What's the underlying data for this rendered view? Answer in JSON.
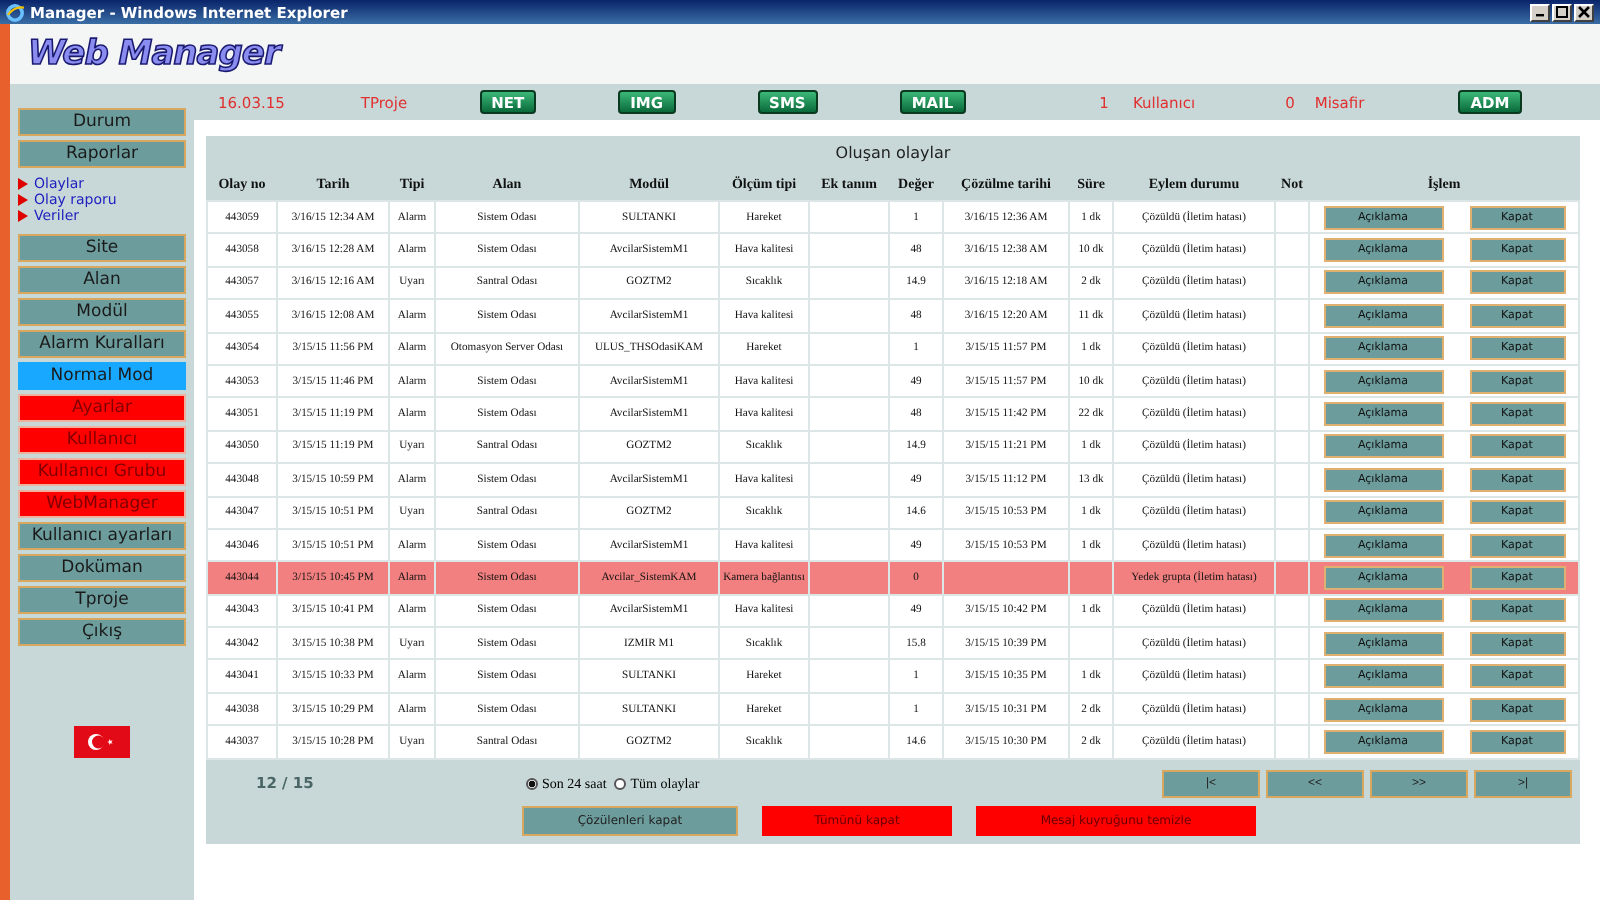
{
  "window": {
    "title": "Manager - Windows Internet Explorer"
  },
  "logo": "Web Manager",
  "sidebar": {
    "items": [
      {
        "label": "Durum",
        "kind": "button"
      },
      {
        "label": "Raporlar",
        "kind": "button"
      },
      {
        "label": "Olaylar",
        "kind": "link"
      },
      {
        "label": "Olay raporu",
        "kind": "link"
      },
      {
        "label": "Veriler",
        "kind": "link"
      },
      {
        "label": "Site",
        "kind": "button"
      },
      {
        "label": "Alan",
        "kind": "button"
      },
      {
        "label": "Modül",
        "kind": "button"
      },
      {
        "label": "Alarm Kuralları",
        "kind": "button"
      },
      {
        "label": "Normal Mod",
        "kind": "mode"
      },
      {
        "label": "Ayarlar",
        "kind": "admin"
      },
      {
        "label": "Kullanıcı",
        "kind": "admin"
      },
      {
        "label": "Kullanıcı Grubu",
        "kind": "admin"
      },
      {
        "label": "WebManager",
        "kind": "admin"
      },
      {
        "label": "Kullanıcı ayarları",
        "kind": "button"
      },
      {
        "label": "Doküman",
        "kind": "button"
      },
      {
        "label": "Tproje",
        "kind": "button"
      },
      {
        "label": "Çıkış",
        "kind": "button"
      }
    ]
  },
  "topbar": {
    "date": "16.03.15",
    "project": "TProje",
    "buttons": [
      "NET",
      "IMG",
      "SMS",
      "MAIL"
    ],
    "users_count": "1",
    "users_label": "Kullanıcı",
    "guests_count": "0",
    "guests_label": "Misafir",
    "admin_button": "ADM"
  },
  "events": {
    "title": "Oluşan olaylar",
    "columns": [
      "Olay no",
      "Tarih",
      "Tipi",
      "Alan",
      "Modül",
      "Ölçüm tipi",
      "Ek tanım",
      "Değer",
      "Çözülme tarihi",
      "Süre",
      "Eylem durumu",
      "Not",
      "İşlem"
    ],
    "rows": [
      {
        "cells": [
          "443059",
          "3/16/15 12:34 AM",
          "Alarm",
          "Sistem Odası",
          "SULTANKI",
          "Hareket",
          "",
          "1",
          "3/16/15 12:36 AM",
          "1 dk",
          "Çözüldü (İletim hatası)",
          ""
        ],
        "actions": [
          "Açıklama",
          "Kapat"
        ],
        "highlighted": false
      },
      {
        "cells": [
          "443058",
          "3/16/15 12:28 AM",
          "Alarm",
          "Sistem Odası",
          "AvcilarSistemM1",
          "Hava kalitesi",
          "",
          "48",
          "3/16/15 12:38 AM",
          "10 dk",
          "Çözüldü (İletim hatası)",
          ""
        ],
        "actions": [
          "Açıklama",
          "Kapat"
        ],
        "highlighted": false
      },
      {
        "cells": [
          "443057",
          "3/16/15 12:16 AM",
          "Uyarı",
          "Santral Odası",
          "GOZTM2",
          "Sıcaklık",
          "",
          "14.9",
          "3/16/15 12:18 AM",
          "2 dk",
          "Çözüldü (İletim hatası)",
          ""
        ],
        "actions": [
          "Açıklama",
          "Kapat"
        ],
        "highlighted": false
      },
      {
        "cells": [
          "443055",
          "3/16/15 12:08 AM",
          "Alarm",
          "Sistem Odası",
          "AvcilarSistemM1",
          "Hava kalitesi",
          "",
          "48",
          "3/16/15 12:20 AM",
          "11 dk",
          "Çözüldü (İletim hatası)",
          ""
        ],
        "actions": [
          "Açıklama",
          "Kapat"
        ],
        "highlighted": false
      },
      {
        "cells": [
          "443054",
          "3/15/15 11:56 PM",
          "Alarm",
          "Otomasyon Server Odası",
          "ULUS_THSOdasiKAM",
          "Hareket",
          "",
          "1",
          "3/15/15 11:57 PM",
          "1 dk",
          "Çözüldü (İletim hatası)",
          ""
        ],
        "actions": [
          "Açıklama",
          "Kapat"
        ],
        "highlighted": false
      },
      {
        "cells": [
          "443053",
          "3/15/15 11:46 PM",
          "Alarm",
          "Sistem Odası",
          "AvcilarSistemM1",
          "Hava kalitesi",
          "",
          "49",
          "3/15/15 11:57 PM",
          "10 dk",
          "Çözüldü (İletim hatası)",
          ""
        ],
        "actions": [
          "Açıklama",
          "Kapat"
        ],
        "highlighted": false
      },
      {
        "cells": [
          "443051",
          "3/15/15 11:19 PM",
          "Alarm",
          "Sistem Odası",
          "AvcilarSistemM1",
          "Hava kalitesi",
          "",
          "48",
          "3/15/15 11:42 PM",
          "22 dk",
          "Çözüldü (İletim hatası)",
          ""
        ],
        "actions": [
          "Açıklama",
          "Kapat"
        ],
        "highlighted": false
      },
      {
        "cells": [
          "443050",
          "3/15/15 11:19 PM",
          "Uyarı",
          "Santral Odası",
          "GOZTM2",
          "Sıcaklık",
          "",
          "14.9",
          "3/15/15 11:21 PM",
          "1 dk",
          "Çözüldü (İletim hatası)",
          ""
        ],
        "actions": [
          "Açıklama",
          "Kapat"
        ],
        "highlighted": false
      },
      {
        "cells": [
          "443048",
          "3/15/15 10:59 PM",
          "Alarm",
          "Sistem Odası",
          "AvcilarSistemM1",
          "Hava kalitesi",
          "",
          "49",
          "3/15/15 11:12 PM",
          "13 dk",
          "Çözüldü (İletim hatası)",
          ""
        ],
        "actions": [
          "Açıklama",
          "Kapat"
        ],
        "highlighted": false
      },
      {
        "cells": [
          "443047",
          "3/15/15 10:51 PM",
          "Uyarı",
          "Santral Odası",
          "GOZTM2",
          "Sıcaklık",
          "",
          "14.6",
          "3/15/15 10:53 PM",
          "1 dk",
          "Çözüldü (İletim hatası)",
          ""
        ],
        "actions": [
          "Açıklama",
          "Kapat"
        ],
        "highlighted": false
      },
      {
        "cells": [
          "443046",
          "3/15/15 10:51 PM",
          "Alarm",
          "Sistem Odası",
          "AvcilarSistemM1",
          "Hava kalitesi",
          "",
          "49",
          "3/15/15 10:53 PM",
          "1 dk",
          "Çözüldü (İletim hatası)",
          ""
        ],
        "actions": [
          "Açıklama",
          "Kapat"
        ],
        "highlighted": false
      },
      {
        "cells": [
          "443044",
          "3/15/15 10:45 PM",
          "Alarm",
          "Sistem Odası",
          "Avcilar_SistemKAM",
          "Kamera bağlantısı",
          "",
          "0",
          "",
          "",
          "Yedek grupta (İletim hatası)",
          ""
        ],
        "actions": [
          "Açıklama",
          "Kapat"
        ],
        "highlighted": true
      },
      {
        "cells": [
          "443043",
          "3/15/15 10:41 PM",
          "Alarm",
          "Sistem Odası",
          "AvcilarSistemM1",
          "Hava kalitesi",
          "",
          "49",
          "3/15/15 10:42 PM",
          "1 dk",
          "Çözüldü (İletim hatası)",
          ""
        ],
        "actions": [
          "Açıklama",
          "Kapat"
        ],
        "highlighted": false
      },
      {
        "cells": [
          "443042",
          "3/15/15 10:38 PM",
          "Uyarı",
          "Sistem Odası",
          "IZMIR M1",
          "Sıcaklık",
          "",
          "15.8",
          "3/15/15 10:39 PM",
          "",
          "Çözüldü (İletim hatası)",
          ""
        ],
        "actions": [
          "Açıklama",
          "Kapat"
        ],
        "highlighted": false
      },
      {
        "cells": [
          "443041",
          "3/15/15 10:33 PM",
          "Alarm",
          "Sistem Odası",
          "SULTANKI",
          "Hareket",
          "",
          "1",
          "3/15/15 10:35 PM",
          "1 dk",
          "Çözüldü (İletim hatası)",
          ""
        ],
        "actions": [
          "Açıklama",
          "Kapat"
        ],
        "highlighted": false
      },
      {
        "cells": [
          "443038",
          "3/15/15 10:29 PM",
          "Alarm",
          "Sistem Odası",
          "SULTANKI",
          "Hareket",
          "",
          "1",
          "3/15/15 10:31 PM",
          "2 dk",
          "Çözüldü (İletim hatası)",
          ""
        ],
        "actions": [
          "Açıklama",
          "Kapat"
        ],
        "highlighted": false
      },
      {
        "cells": [
          "443037",
          "3/15/15 10:28 PM",
          "Uyarı",
          "Santral Odası",
          "GOZTM2",
          "Sıcaklık",
          "",
          "14.6",
          "3/15/15 10:30 PM",
          "2 dk",
          "Çözüldü (İletim hatası)",
          ""
        ],
        "actions": [
          "Açıklama",
          "Kapat"
        ],
        "highlighted": false
      }
    ]
  },
  "footer": {
    "page": "12 / 15",
    "radios": [
      {
        "label": "Son 24 saat",
        "selected": true
      },
      {
        "label": "Tüm olaylar",
        "selected": false
      }
    ],
    "pager": [
      "|<",
      "<<",
      ">>",
      ">|"
    ],
    "buttons": [
      {
        "label": "Çözülenleri kapat",
        "kind": "normal"
      },
      {
        "label": "Tümünü kapat",
        "kind": "danger"
      },
      {
        "label": "Mesaj kuyruğunu temizle",
        "kind": "danger"
      }
    ]
  }
}
